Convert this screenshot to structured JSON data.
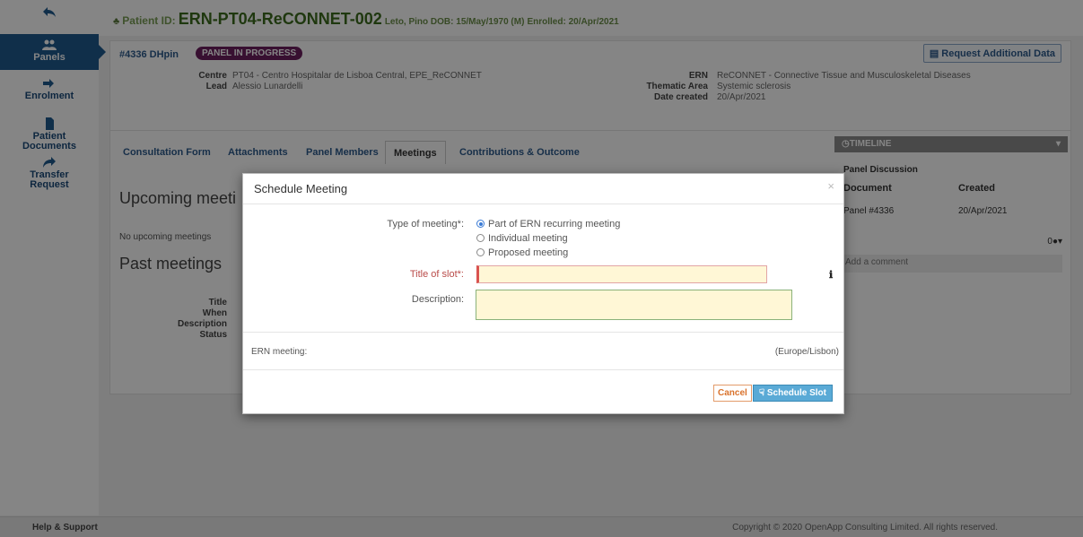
{
  "sidebar": {
    "items": [
      {
        "label": "",
        "icon": "back-arrow-icon"
      },
      {
        "label": "Panels",
        "icon": "users-icon"
      },
      {
        "label": "Enrolment",
        "icon": "sign-in-icon"
      },
      {
        "label": "Patient Documents",
        "icon": "document-icon"
      },
      {
        "label": "Transfer Request",
        "icon": "share-arrow-icon"
      }
    ]
  },
  "header": {
    "patient_label": "Patient ID:",
    "patient_id": "ERN-PT04-ReCONNET-002",
    "patient_info": "Leto, Pino DOB: 15/May/1970 (M)",
    "enrolled": "Enrolled: 20/Apr/2021"
  },
  "panel": {
    "id": "#4336 DHpin",
    "status_badge": "PANEL IN PROGRESS",
    "request_button": "Request Additional Data",
    "centre_label": "Centre",
    "centre": "PT04 - Centro Hospitalar de Lisboa Central, EPE_ReCONNET",
    "lead_label": "Lead",
    "lead": "Alessio Lunardelli",
    "ern_label": "ERN",
    "ern": "ReCONNET - Connective Tissue and Musculoskeletal Diseases",
    "thematic_label": "Thematic Area",
    "thematic": "Systemic sclerosis",
    "created_label": "Date created",
    "created": "20/Apr/2021"
  },
  "tabs": [
    "Consultation Form",
    "Attachments",
    "Panel Members",
    "Meetings",
    "Contributions & Outcome"
  ],
  "active_tab": "Meetings",
  "meetings": {
    "upcoming_heading": "Upcoming meeti",
    "no_upcoming": "No upcoming meetings",
    "past_heading": "Past meetings",
    "fields": [
      "Title",
      "When",
      "Description",
      "Status"
    ]
  },
  "timeline": {
    "header": "TIMELINE",
    "section": "Panel Discussion",
    "col_document": "Document",
    "col_created": "Created",
    "row_document": "Panel #4336",
    "row_created": "20/Apr/2021",
    "comment_count": "0",
    "comment_placeholder": "Add a comment"
  },
  "modal": {
    "title": "Schedule Meeting",
    "close": "×",
    "type_label": "Type of meeting*:",
    "options": [
      "Part of ERN recurring meeting",
      "Individual meeting",
      "Proposed meeting"
    ],
    "selected_option": 0,
    "slot_title_label": "Title of slot*:",
    "slot_title_value": "",
    "description_label": "Description:",
    "description_value": "",
    "ern_meeting_label": "ERN meeting:",
    "timezone": "(Europe/Lisbon)",
    "cancel": "Cancel",
    "schedule": "Schedule Slot"
  },
  "footer": {
    "help": "Help & Support",
    "copyright": "Copyright © 2020 OpenApp Consulting Limited. All rights reserved."
  },
  "colors": {
    "brand_blue": "#1f5a8f",
    "patient_green": "#3d6b1e",
    "badge_purple": "#6b1f5f",
    "schedule_button": "#5aaad6",
    "cancel_orange": "#d9722c",
    "required_red": "#d9534f",
    "input_yellow": "#fff7d6"
  }
}
